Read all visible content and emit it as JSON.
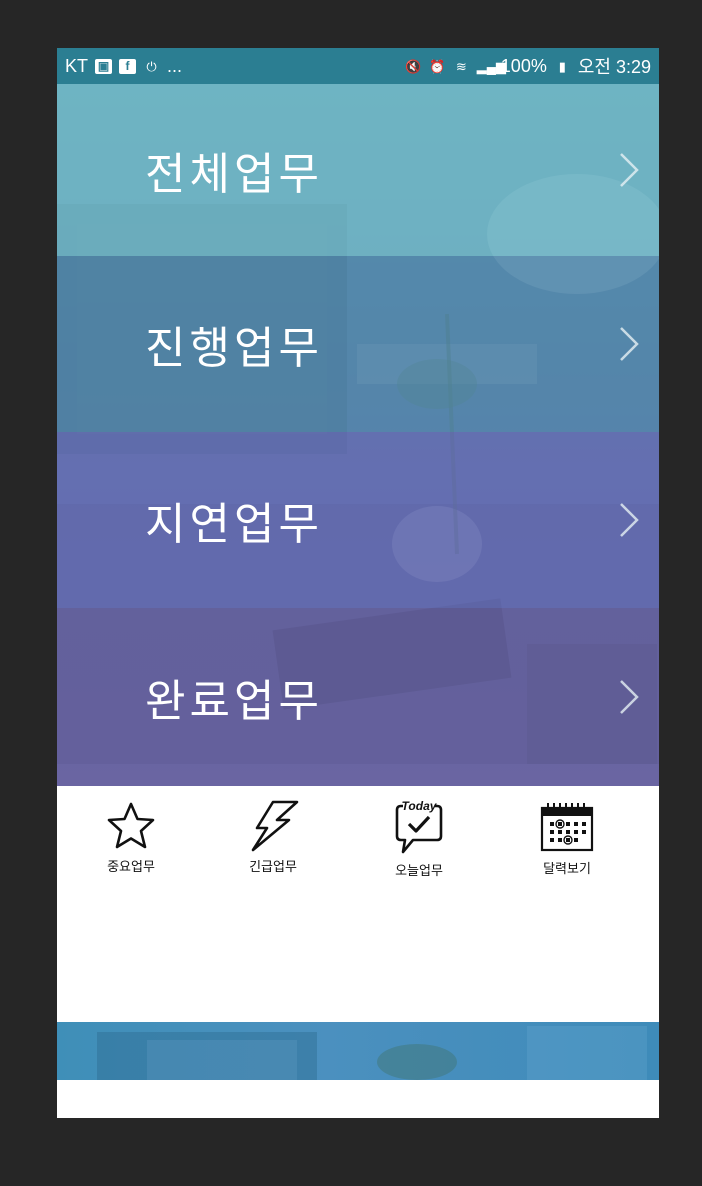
{
  "status_bar": {
    "carrier": "KT",
    "more": "...",
    "battery": "100%",
    "time": "오전 3:29"
  },
  "menu": {
    "items": [
      {
        "label": "전체업무",
        "icon": "chevron-right-icon"
      },
      {
        "label": "진행업무",
        "icon": "chevron-right-icon"
      },
      {
        "label": "지연업무",
        "icon": "chevron-right-icon"
      },
      {
        "label": "완료업무",
        "icon": "chevron-right-icon"
      }
    ]
  },
  "quick_menu": {
    "items": [
      {
        "label": "중요업무",
        "icon": "star-icon"
      },
      {
        "label": "긴급업무",
        "icon": "lightning-icon"
      },
      {
        "label": "오늘업무",
        "icon": "today-check-icon",
        "icon_text": "Today"
      },
      {
        "label": "달력보기",
        "icon": "calendar-icon"
      }
    ]
  },
  "colors": {
    "status_bar": "#2b7e92",
    "row_all": "#76c0cd",
    "row_progress": "#508ab0",
    "row_delayed": "#656cb6",
    "row_done": "#6860a0",
    "banner": "#3f8fb8"
  }
}
